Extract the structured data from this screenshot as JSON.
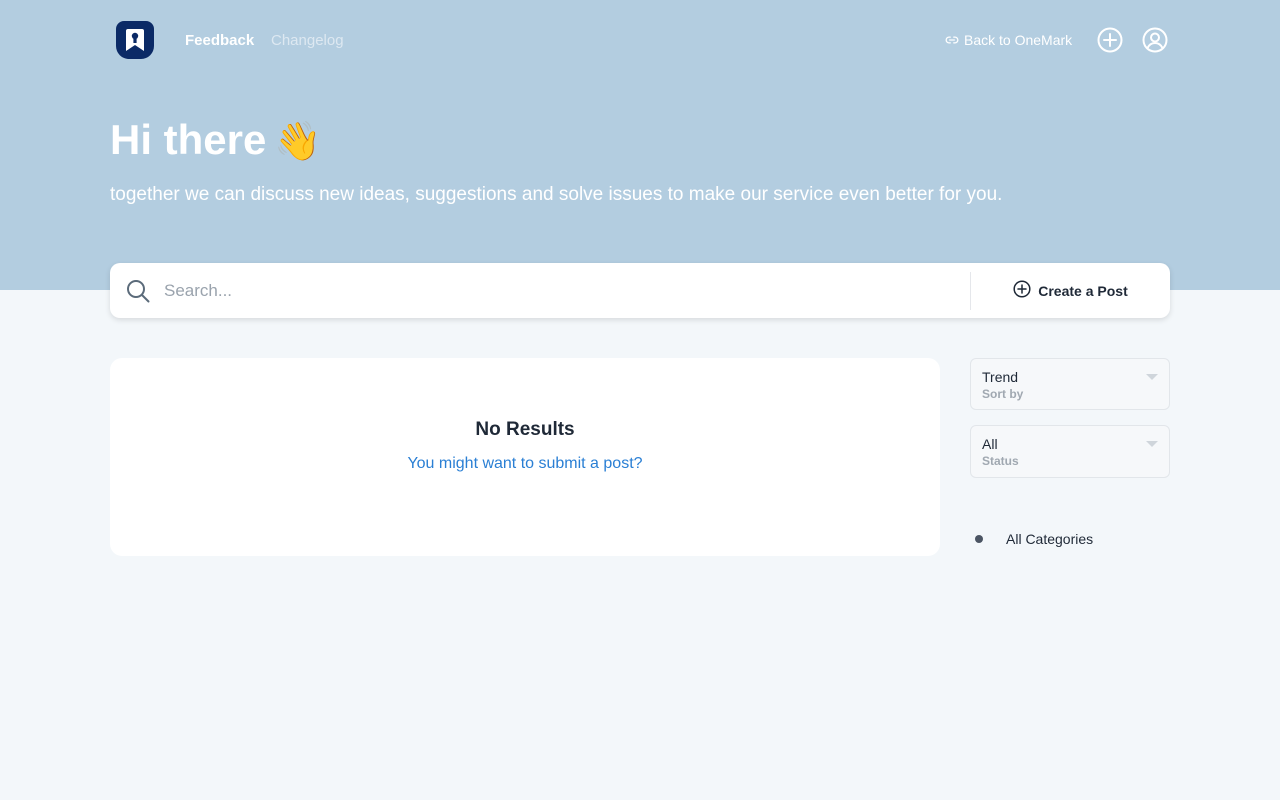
{
  "nav": {
    "feedback": "Feedback",
    "changelog": "Changelog",
    "back_link": "Back to OneMark"
  },
  "hero": {
    "title": "Hi there",
    "emoji": "👋",
    "subtitle": "together we can discuss new ideas, suggestions and solve issues to make our service even better for you."
  },
  "search": {
    "placeholder": "Search...",
    "value": "",
    "create_post": "Create a Post"
  },
  "results": {
    "heading": "No Results",
    "link": "You might want to submit a post?"
  },
  "filters": {
    "sort": {
      "value": "Trend",
      "label": "Sort by"
    },
    "status": {
      "value": "All",
      "label": "Status"
    }
  },
  "categories": {
    "all": "All Categories"
  },
  "icons": {
    "logo": "bookmark-logo-icon",
    "back": "link-icon",
    "add": "plus-circle-icon",
    "user": "user-circle-icon",
    "search": "search-icon",
    "create": "plus-circle-icon"
  },
  "colors": {
    "hero_bg": "#b3cde0",
    "page_bg": "#f3f7fa",
    "logo_bg": "#0b2a66",
    "link": "#2a7fd4"
  }
}
